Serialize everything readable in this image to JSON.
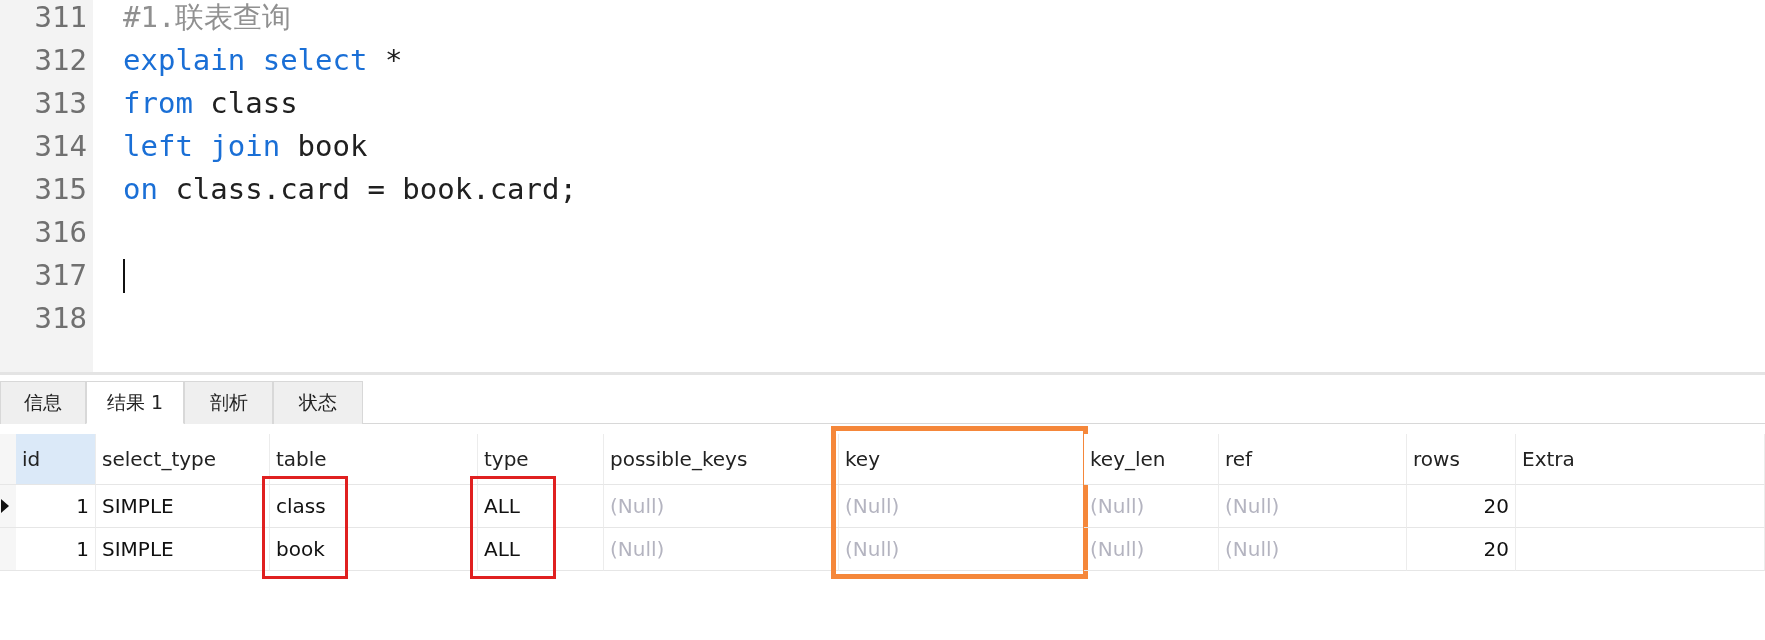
{
  "editor": {
    "lines": [
      {
        "number": "311",
        "tokens": [
          {
            "kind": "comment",
            "text": "#1.联表查询"
          }
        ]
      },
      {
        "number": "312",
        "tokens": [
          {
            "kind": "keyword",
            "text": "explain select"
          },
          {
            "kind": "plain",
            "text": " *"
          }
        ]
      },
      {
        "number": "313",
        "tokens": [
          {
            "kind": "keyword",
            "text": "from"
          },
          {
            "kind": "plain",
            "text": " class"
          }
        ]
      },
      {
        "number": "314",
        "tokens": [
          {
            "kind": "keyword",
            "text": "left join"
          },
          {
            "kind": "plain",
            "text": " book"
          }
        ]
      },
      {
        "number": "315",
        "tokens": [
          {
            "kind": "keyword",
            "text": "on"
          },
          {
            "kind": "plain",
            "text": " class.card = book.card;"
          }
        ]
      },
      {
        "number": "316"
      },
      {
        "number": "317",
        "cursor": true
      },
      {
        "number": "318"
      }
    ]
  },
  "tabs": [
    {
      "label": "信息",
      "selected": false
    },
    {
      "label": "结果 1",
      "selected": true
    },
    {
      "label": "剖析",
      "selected": false
    },
    {
      "label": "状态",
      "selected": false
    }
  ],
  "table": {
    "columns": [
      {
        "label": "id",
        "highlighted": true
      },
      {
        "label": "select_type",
        "highlighted": false
      },
      {
        "label": "table",
        "highlighted": false,
        "annotation": {
          "color": "#e02020",
          "covers_header": false
        }
      },
      {
        "label": "type",
        "highlighted": false,
        "annotation": {
          "color": "#e02020",
          "covers_header": false
        }
      },
      {
        "label": "possible_keys",
        "highlighted": false
      },
      {
        "label": "key",
        "highlighted": false,
        "annotation": {
          "color": "#f5873a",
          "covers_header": true
        }
      },
      {
        "label": "key_len",
        "highlighted": false
      },
      {
        "label": "ref",
        "highlighted": false
      },
      {
        "label": "rows",
        "highlighted": false
      },
      {
        "label": "Extra",
        "highlighted": false
      }
    ],
    "rows": [
      {
        "current": true,
        "cells": [
          {
            "text": "1",
            "null": false
          },
          {
            "text": "SIMPLE",
            "null": false
          },
          {
            "text": "class",
            "null": false
          },
          {
            "text": "ALL",
            "null": false
          },
          {
            "text": "(Null)",
            "null": true
          },
          {
            "text": "(Null)",
            "null": true
          },
          {
            "text": "(Null)",
            "null": true
          },
          {
            "text": "(Null)",
            "null": true
          },
          {
            "text": "20",
            "null": false
          }
        ]
      },
      {
        "current": false,
        "cells": [
          {
            "text": "1",
            "null": false
          },
          {
            "text": "SIMPLE",
            "null": false
          },
          {
            "text": "book",
            "null": false
          },
          {
            "text": "ALL",
            "null": false
          },
          {
            "text": "(Null)",
            "null": true
          },
          {
            "text": "(Null)",
            "null": true
          },
          {
            "text": "(Null)",
            "null": true
          },
          {
            "text": "(Null)",
            "null": true
          },
          {
            "text": "20",
            "null": false
          }
        ]
      }
    ]
  }
}
